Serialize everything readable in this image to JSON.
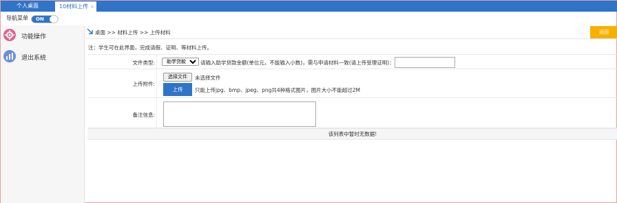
{
  "tabs": {
    "home": "个人桌面",
    "active": "10材料上传",
    "close_glyph": "×"
  },
  "nav": {
    "label": "导航菜单",
    "toggle": "ON"
  },
  "sidebar": {
    "items": [
      {
        "label": "功能操作",
        "icon": "function-gear-icon",
        "color": "#e0648a"
      },
      {
        "label": "退出系统",
        "icon": "exit-chart-icon",
        "color": "#6b8fd6"
      }
    ]
  },
  "breadcrumb": {
    "text": "桌面 >> 材料上传 >> 上传材料",
    "back_label": "返回"
  },
  "note": "注：学生可在此界面，完成请假、证明、等材料上传。",
  "form": {
    "file_type_label": "文件类型:",
    "file_type_value": "助学贷款",
    "file_type_options": [
      "助学贷款"
    ],
    "loan_hint": "请输入助学贷款金额(单位元，不能输入小数)，需与申请材料一致(请上传受理证明)：",
    "amount_value": "",
    "attachment_label": "上传附件:",
    "choose_file_label": "选择文件",
    "no_file_text": "未选择文件",
    "upload_label": "上传",
    "upload_hint": "只能上传jpg、bmp、jpeg、png共4种格式图片，图片大小不能超过2M",
    "remark_label": "备注信息:",
    "remark_value": ""
  },
  "table": {
    "empty_text": "该列表中暂时无数据!"
  },
  "colors": {
    "primary": "#2f74c8",
    "back_button": "#f6b100"
  }
}
